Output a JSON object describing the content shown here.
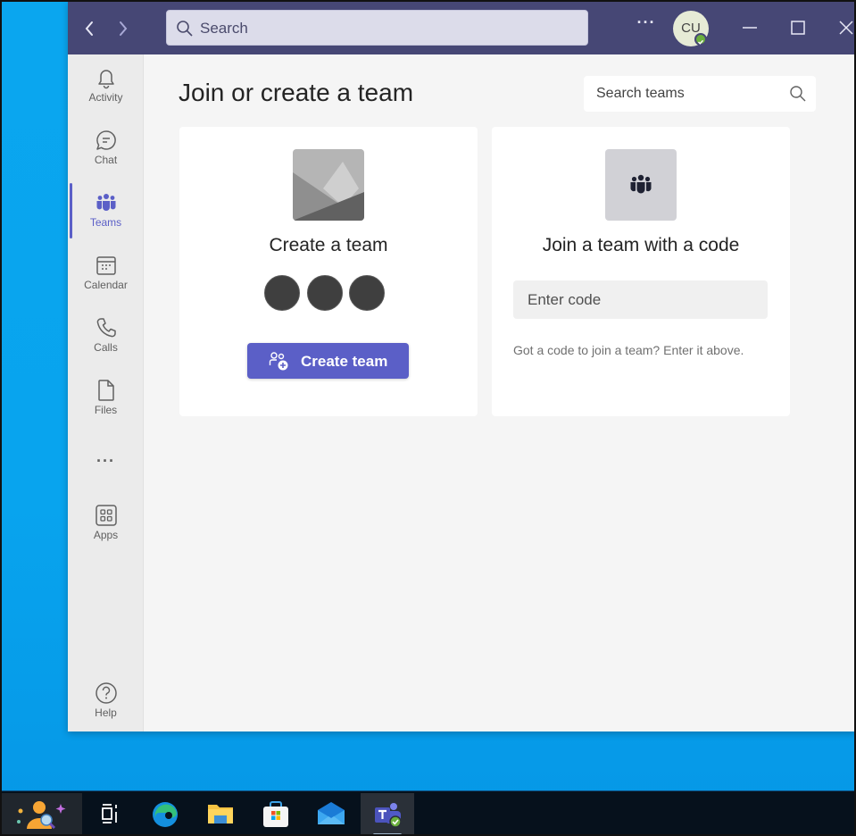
{
  "titlebar": {
    "search_placeholder": "Search",
    "more_label": "···",
    "avatar_initials": "CU",
    "presence_status": "available"
  },
  "rail": {
    "items": [
      {
        "label": "Activity",
        "icon": "bell-icon"
      },
      {
        "label": "Chat",
        "icon": "chat-icon"
      },
      {
        "label": "Teams",
        "icon": "teams-icon",
        "active": true
      },
      {
        "label": "Calendar",
        "icon": "calendar-icon"
      },
      {
        "label": "Calls",
        "icon": "phone-icon"
      },
      {
        "label": "Files",
        "icon": "file-icon"
      },
      {
        "label": "Apps",
        "icon": "apps-icon"
      },
      {
        "label": "Help",
        "icon": "help-icon"
      }
    ],
    "more_label": "···"
  },
  "main": {
    "title": "Join or create a team",
    "search_teams_placeholder": "Search teams",
    "create_card": {
      "title": "Create a team",
      "button_label": "Create team",
      "member_count": 3
    },
    "join_card": {
      "title": "Join a team with a code",
      "code_placeholder": "Enter code",
      "hint": "Got a code to join a team? Enter it above."
    }
  },
  "taskbar": {
    "items": [
      "widgets",
      "task-view",
      "edge",
      "file-explorer",
      "microsoft-store",
      "mail",
      "teams"
    ],
    "active": "teams"
  },
  "colors": {
    "titlebar": "#464775",
    "accent": "#5b5fc7",
    "desktop": "#0aa6ef",
    "taskbar": "#06111c"
  }
}
